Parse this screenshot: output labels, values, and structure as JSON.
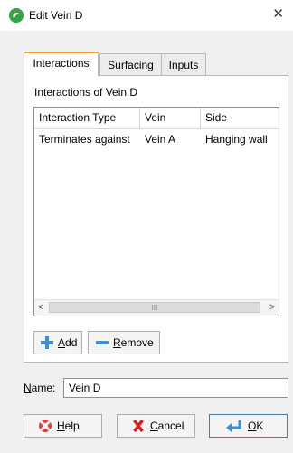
{
  "window": {
    "title": "Edit Vein D",
    "close_glyph": "✕"
  },
  "tabs": [
    {
      "label": "Interactions",
      "active": true
    },
    {
      "label": "Surfacing",
      "active": false
    },
    {
      "label": "Inputs",
      "active": false
    }
  ],
  "section_label": "Interactions of Vein D",
  "table": {
    "columns": [
      "Interaction Type",
      "Vein",
      "Side"
    ],
    "rows": [
      [
        "Terminates against",
        "Vein A",
        "Hanging wall"
      ]
    ],
    "scroll_grip": "III"
  },
  "buttons": {
    "add": {
      "label": "Add",
      "mnemonic": "A",
      "rest": "dd",
      "icon": "plus-icon"
    },
    "remove": {
      "label": "Remove",
      "mnemonic": "R",
      "rest": "emove",
      "icon": "minus-icon"
    },
    "help": {
      "label": "Help",
      "mnemonic": "H",
      "rest": "elp",
      "icon": "lifebuoy-icon"
    },
    "cancel": {
      "label": "Cancel",
      "mnemonic": "C",
      "rest": "ancel",
      "icon": "cross-icon"
    },
    "ok": {
      "label": "OK",
      "mnemonic": "O",
      "rest": "K",
      "icon": "enter-arrow-icon"
    }
  },
  "name_field": {
    "label": "Name:",
    "label_mnemonic": "N",
    "label_rest": "ame:",
    "value": "Vein D"
  },
  "colors": {
    "accent_tab": "#f0a030",
    "app_icon": "#37a248",
    "plus": "#3a8fd6",
    "cancel_red": "#d32020"
  }
}
